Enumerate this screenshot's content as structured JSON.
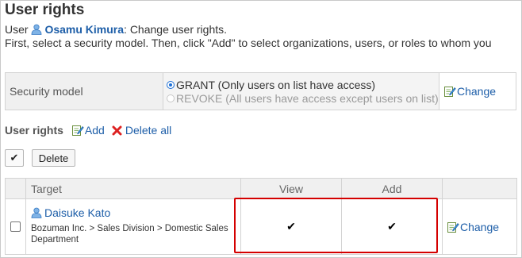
{
  "page": {
    "title": "User rights",
    "user_prefix": "User",
    "user_name": "Osamu Kimura",
    "user_suffix": ": Change user rights.",
    "instructions": "First, select a security model. Then, click \"Add\" to select organizations, users, or roles to whom you"
  },
  "security_model": {
    "label": "Security model",
    "options": [
      {
        "label": "GRANT (Only users on list have access)",
        "selected": true,
        "disabled": false
      },
      {
        "label": "REVOKE (All users have access except users on list)",
        "selected": false,
        "disabled": true
      }
    ],
    "change_label": "Change"
  },
  "user_rights": {
    "label": "User rights",
    "add_label": "Add",
    "delete_all_label": "Delete all"
  },
  "toolbar": {
    "select_all_glyph": "✔",
    "delete_label": "Delete"
  },
  "table": {
    "headers": {
      "target": "Target",
      "view": "View",
      "add": "Add"
    },
    "rows": [
      {
        "target_name": "Daisuke Kato",
        "target_org": "Bozuman Inc. > Sales Division > Domestic Sales Department",
        "view": "✔",
        "add": "✔",
        "change_label": "Change"
      }
    ]
  },
  "colors": {
    "link": "#1d5ea8",
    "highlight": "#d40000",
    "header_bg": "#f0f0f0"
  },
  "icons": {
    "user": "user-icon",
    "edit": "edit-icon",
    "delete": "red-x-icon"
  }
}
